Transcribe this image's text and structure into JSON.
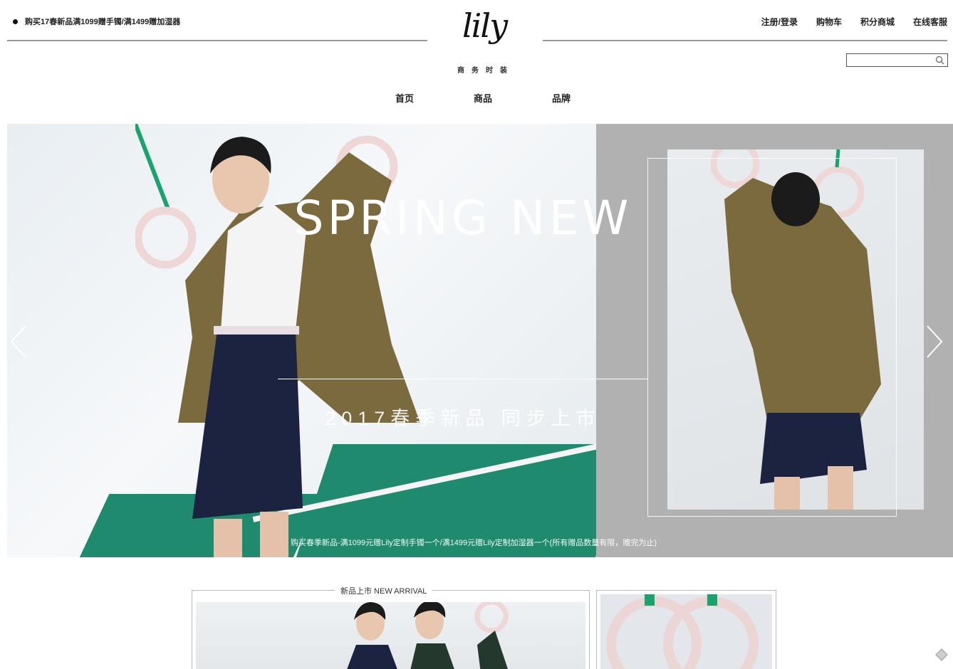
{
  "promo": {
    "text": "购买17春新品满1099赠手镯/满1499赠加湿器"
  },
  "logo": {
    "script": "lily",
    "subtitle": "商务时装"
  },
  "toplinks": [
    "注册/登录",
    "购物车",
    "积分商城",
    "在线客服"
  ],
  "search": {
    "placeholder": "",
    "value": ""
  },
  "nav": [
    "首页",
    "商品",
    "品牌"
  ],
  "hero": {
    "title": "SPRING NEW",
    "subtitle": "2017春季新品 同步上市",
    "note": "购买春季新品-满1099元赠Lily定制手镯一个/满1499元赠Lily定制加湿器一个(所有赠品数量有限，赠完为止)"
  },
  "new_arrival": {
    "title": "新品上市 NEW ARRIVAL"
  },
  "icons": [
    "bullet-dot-icon",
    "search-icon",
    "chevron-left-icon",
    "chevron-right-icon",
    "back-to-top-icon"
  ],
  "colors": {
    "accent_green": "#1f8a6e",
    "hero_right_bg": "#b1b1b1",
    "coat": "#7a6a3e",
    "skirt": "#1c2340"
  }
}
